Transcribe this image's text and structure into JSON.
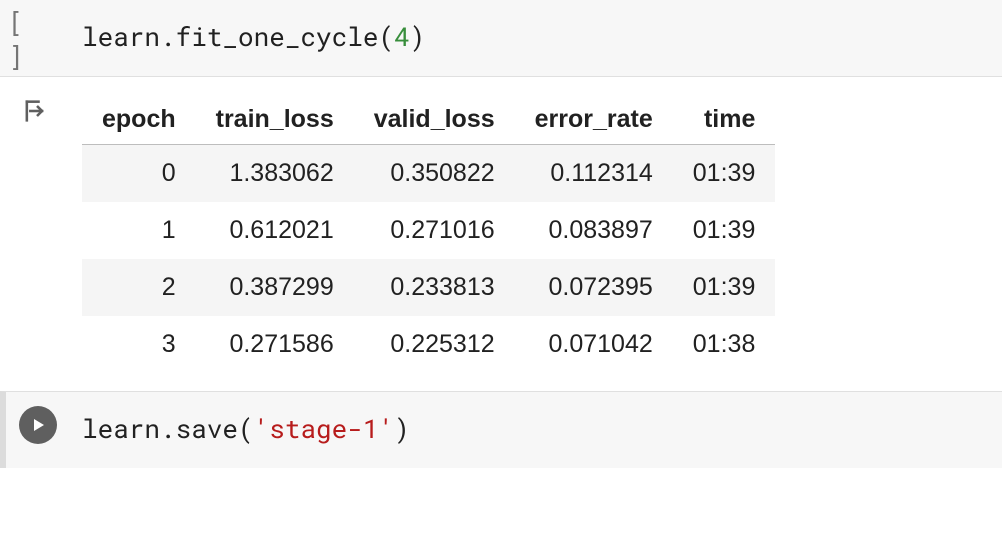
{
  "cell1": {
    "exec_marker": "[ ]",
    "code_prefix": "learn.fit_one_cycle(",
    "code_arg": "4",
    "code_suffix": ")"
  },
  "output": {
    "headers": [
      "epoch",
      "train_loss",
      "valid_loss",
      "error_rate",
      "time"
    ],
    "rows": [
      {
        "epoch": "0",
        "train_loss": "1.383062",
        "valid_loss": "0.350822",
        "error_rate": "0.112314",
        "time": "01:39"
      },
      {
        "epoch": "1",
        "train_loss": "0.612021",
        "valid_loss": "0.271016",
        "error_rate": "0.083897",
        "time": "01:39"
      },
      {
        "epoch": "2",
        "train_loss": "0.387299",
        "valid_loss": "0.233813",
        "error_rate": "0.072395",
        "time": "01:39"
      },
      {
        "epoch": "3",
        "train_loss": "0.271586",
        "valid_loss": "0.225312",
        "error_rate": "0.071042",
        "time": "01:38"
      }
    ]
  },
  "cell2": {
    "code_prefix": "learn.save(",
    "code_str": "'stage-1'",
    "code_suffix": ")"
  },
  "chart_data": {
    "type": "table",
    "title": "",
    "columns": [
      "epoch",
      "train_loss",
      "valid_loss",
      "error_rate",
      "time"
    ],
    "rows": [
      [
        0,
        1.383062,
        0.350822,
        0.112314,
        "01:39"
      ],
      [
        1,
        0.612021,
        0.271016,
        0.083897,
        "01:39"
      ],
      [
        2,
        0.387299,
        0.233813,
        0.072395,
        "01:39"
      ],
      [
        3,
        0.271586,
        0.225312,
        0.071042,
        "01:38"
      ]
    ]
  }
}
